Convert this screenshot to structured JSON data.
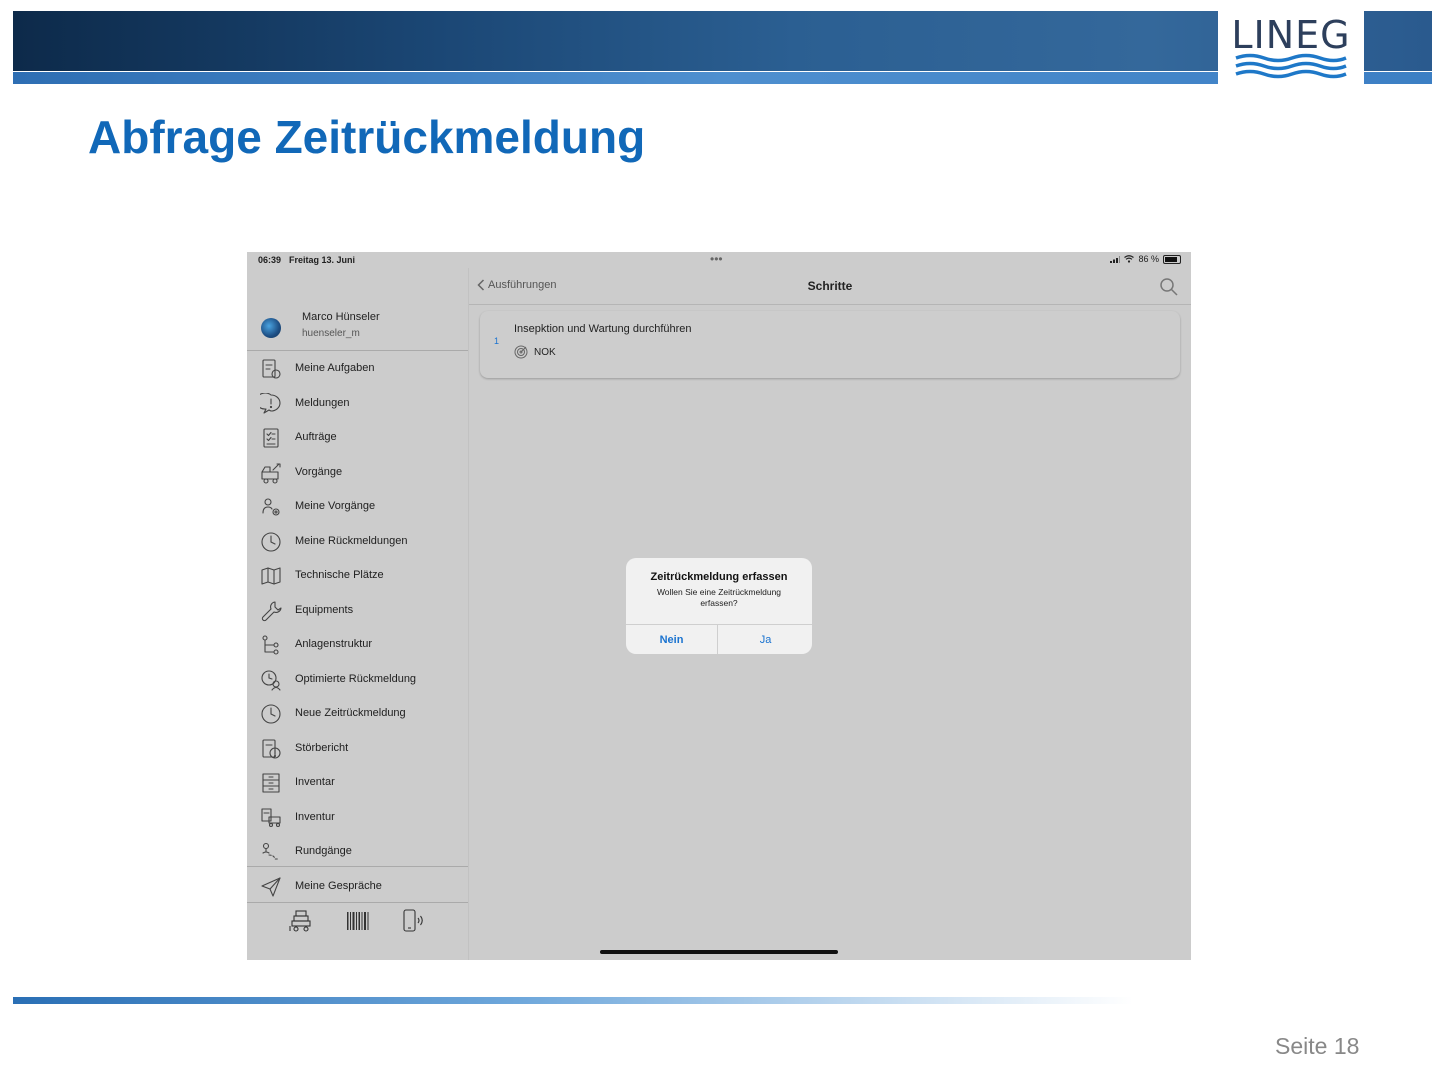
{
  "header": {
    "logo_text": "LINEG"
  },
  "slide": {
    "title": "Abfrage Zeitrückmeldung",
    "page_label": "Seite 18"
  },
  "colors": {
    "title_blue": "#1168b8",
    "ios_blue": "#1a73d0",
    "banner_dark": "#0d2a4a"
  },
  "statusbar": {
    "time": "06:39",
    "date": "Freitag 13. Juni",
    "dots": "•••",
    "battery": "86 %",
    "battery_level": 0.86
  },
  "profile": {
    "name": "Marco Hünseler",
    "username": "huenseler_m"
  },
  "menu": [
    {
      "label": "Meine Aufgaben",
      "icon": "tasks-icon"
    },
    {
      "label": "Meldungen",
      "icon": "speech-bubble-alert-icon"
    },
    {
      "label": "Aufträge",
      "icon": "checklist-icon"
    },
    {
      "label": "Vorgänge",
      "icon": "truck-tools-icon"
    },
    {
      "label": "Meine Vorgänge",
      "icon": "user-gear-icon"
    },
    {
      "label": "Meine Rückmeldungen",
      "icon": "clock-icon"
    },
    {
      "label": "Technische Plätze",
      "icon": "map-icon"
    },
    {
      "label": "Equipments",
      "icon": "wrench-icon"
    },
    {
      "label": "Anlagenstruktur",
      "icon": "hierarchy-icon"
    },
    {
      "label": "Optimierte Rückmeldung",
      "icon": "clock-user-icon"
    },
    {
      "label": "Neue Zeitrückmeldung",
      "icon": "clock-icon"
    },
    {
      "label": "Störbericht",
      "icon": "report-alert-icon"
    },
    {
      "label": "Inventar",
      "icon": "cabinet-icon"
    },
    {
      "label": "Inventur",
      "icon": "inventory-icon"
    },
    {
      "label": "Rundgänge",
      "icon": "route-icon"
    },
    {
      "label": "Meine Gespräche",
      "icon": "paper-plane-icon"
    }
  ],
  "bottom_tools": [
    "forklift-icon",
    "barcode-icon",
    "nfc-phone-icon"
  ],
  "navbar": {
    "back_label": "Ausführungen",
    "title": "Schritte"
  },
  "step": {
    "number": "1",
    "title": "Insepktion und Wartung durchführen",
    "status": "NOK"
  },
  "dialog": {
    "title": "Zeitrückmeldung erfassen",
    "message": "Wollen Sie eine Zeitrückmeldung erfassen?",
    "cancel_label": "Nein",
    "confirm_label": "Ja"
  }
}
